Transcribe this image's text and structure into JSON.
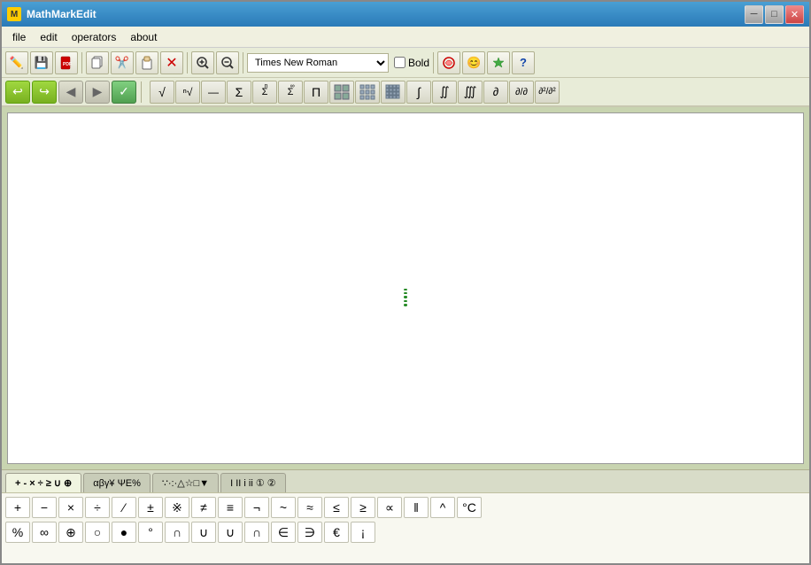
{
  "window": {
    "title": "MathMarkEdit"
  },
  "title_buttons": {
    "minimize": "─",
    "maximize": "□",
    "close": "✕"
  },
  "menu": {
    "items": [
      "file",
      "edit",
      "operators",
      "about"
    ]
  },
  "toolbar1": {
    "font_name": "Times New Roman",
    "bold_label": "Bold",
    "buttons": [
      {
        "name": "pen",
        "icon": "✏️"
      },
      {
        "name": "save",
        "icon": "💾"
      },
      {
        "name": "pdf",
        "icon": "📄"
      },
      {
        "name": "copy",
        "icon": "📋"
      },
      {
        "name": "scissors",
        "icon": "✂️"
      },
      {
        "name": "paste",
        "icon": "📋"
      },
      {
        "name": "delete",
        "icon": "❌"
      },
      {
        "name": "zoom-in",
        "icon": "🔍"
      },
      {
        "name": "zoom-out",
        "icon": "🔍"
      },
      {
        "name": "smiley",
        "icon": "😊"
      },
      {
        "name": "star",
        "icon": "✳️"
      },
      {
        "name": "help",
        "icon": "❓"
      }
    ]
  },
  "toolbar2": {
    "buttons": [
      {
        "name": "sqrt",
        "icon": "√"
      },
      {
        "name": "nth-root",
        "icon": "∜"
      },
      {
        "name": "minus-plus",
        "icon": "∓"
      },
      {
        "name": "sum1",
        "icon": "Σ"
      },
      {
        "name": "sum2",
        "icon": "Σ"
      },
      {
        "name": "sum3",
        "icon": "Σ"
      },
      {
        "name": "product",
        "icon": "Π"
      },
      {
        "name": "matrix1",
        "icon": "▦"
      },
      {
        "name": "matrix2",
        "icon": "▦"
      },
      {
        "name": "matrix3",
        "icon": "▦"
      },
      {
        "name": "integral1",
        "icon": "∫"
      },
      {
        "name": "integral2",
        "icon": "∬"
      },
      {
        "name": "integral3",
        "icon": "∭"
      },
      {
        "name": "partial1",
        "icon": "∂"
      },
      {
        "name": "partial2",
        "icon": "∂∂"
      },
      {
        "name": "partial3",
        "icon": "∂∂∂"
      }
    ]
  },
  "toolbar3": {
    "nav_buttons": [
      {
        "name": "back-green",
        "icon": "↩",
        "style": "green"
      },
      {
        "name": "forward-green",
        "icon": "↪",
        "style": "green"
      },
      {
        "name": "back-grey",
        "icon": "◀",
        "style": "grey"
      },
      {
        "name": "forward-grey",
        "icon": "▶",
        "style": "grey"
      },
      {
        "name": "check",
        "icon": "✓",
        "style": "check"
      }
    ]
  },
  "editor": {
    "cursor_visible": true
  },
  "bottom_tabs": {
    "tabs": [
      {
        "label": "+ - × ÷ ≥ ∪ ⊕",
        "active": true
      },
      {
        "label": "αβγ¥ ΨΕ%",
        "active": false
      },
      {
        "label": "∵·:·△☆□▼",
        "active": false
      },
      {
        "label": "I II  i  ii ① ②",
        "active": false
      }
    ]
  },
  "symbols_row1": [
    "+",
    "−",
    "×",
    "÷",
    "⁄",
    "±",
    "※",
    "≠",
    "≡",
    "¬",
    "~",
    "≈",
    "≤",
    "≥",
    "∝",
    "‖",
    "^",
    "°C"
  ],
  "symbols_row2": [
    "%",
    "∞",
    "⊕",
    "○",
    "●",
    "°",
    "∩",
    "∪",
    "∪",
    "∩",
    "∈",
    "∋",
    "€",
    "¡"
  ]
}
